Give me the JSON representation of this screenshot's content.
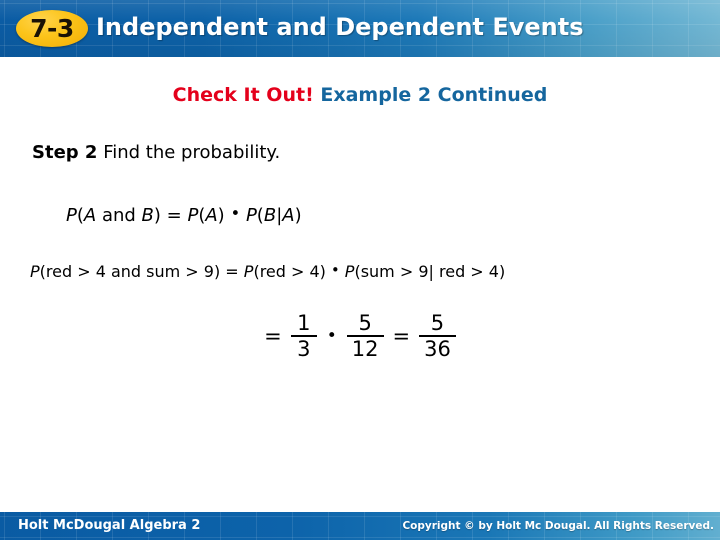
{
  "header": {
    "badge": "7-3",
    "title": "Independent and Dependent Events",
    "colors": {
      "blue_dark": "#0b5ca4",
      "blue_light": "#74b8d4",
      "badge_yellow": "#fcc41a",
      "title_text": "#ffffff"
    }
  },
  "subtitle": {
    "highlight": "Check It Out!",
    "rest": "Example 2 Continued",
    "highlight_color": "#e4001b",
    "rest_color": "#15669e"
  },
  "step": {
    "label": "Step 2",
    "text": "Find the probability."
  },
  "formula_general": {
    "p1": "P",
    "lparen1": "(",
    "a1": "A",
    "and": " and ",
    "b1": "B",
    "rparen1": ")",
    "equals": " = ",
    "p2": "P",
    "lparen2": "(",
    "a2": "A",
    "rparen2": ")",
    "dot": "•",
    "p3": "P",
    "lparen3": "(",
    "b2": "B",
    "bar": "|",
    "a3": "A",
    "rparen3": ")",
    "plain": "P(A and B) = P(A) • P(B|A)"
  },
  "formula_applied": {
    "p1": "P",
    "left_event": "(red > 4 and sum > 9)",
    "equals": " = ",
    "p2": "P",
    "first_factor": "(red > 4)",
    "dot": "•",
    "p3": "P",
    "second_factor": "(sum > 9| red > 4)",
    "plain": "P(red > 4 and sum > 9) = P(red > 4) • P(sum > 9| red > 4)"
  },
  "fraction_line": {
    "equals_1": "=",
    "frac_1": {
      "numerator": "1",
      "denominator": "3"
    },
    "multiply": "•",
    "frac_2": {
      "numerator": "5",
      "denominator": "12"
    },
    "equals_2": "=",
    "frac_3": {
      "numerator": "5",
      "denominator": "36"
    }
  },
  "footer": {
    "left": "Holt McDougal Algebra 2",
    "right": "Copyright © by Holt Mc Dougal. All Rights Reserved."
  }
}
